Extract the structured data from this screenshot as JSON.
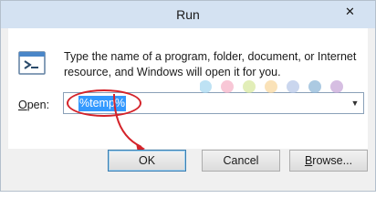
{
  "window": {
    "title": "Run",
    "close_label": "✕"
  },
  "description": "Type the name of a program, folder, document, or Internet resource, and Windows will open it for you.",
  "open": {
    "label_prefix": "",
    "label_accel": "O",
    "label_rest": "pen:",
    "value": "%temp%"
  },
  "buttons": {
    "ok": "OK",
    "cancel": "Cancel",
    "browse_accel": "B",
    "browse_rest": "rowse..."
  },
  "colors": {
    "annotation": "#d4232a",
    "selection": "#3399ff"
  },
  "watermark": {
    "dot_colors": [
      "#a8d8f0",
      "#f5b4c8",
      "#d8e8a0",
      "#f8d8a0",
      "#b8c8e8",
      "#90b8d8",
      "#c8a8d8"
    ]
  }
}
